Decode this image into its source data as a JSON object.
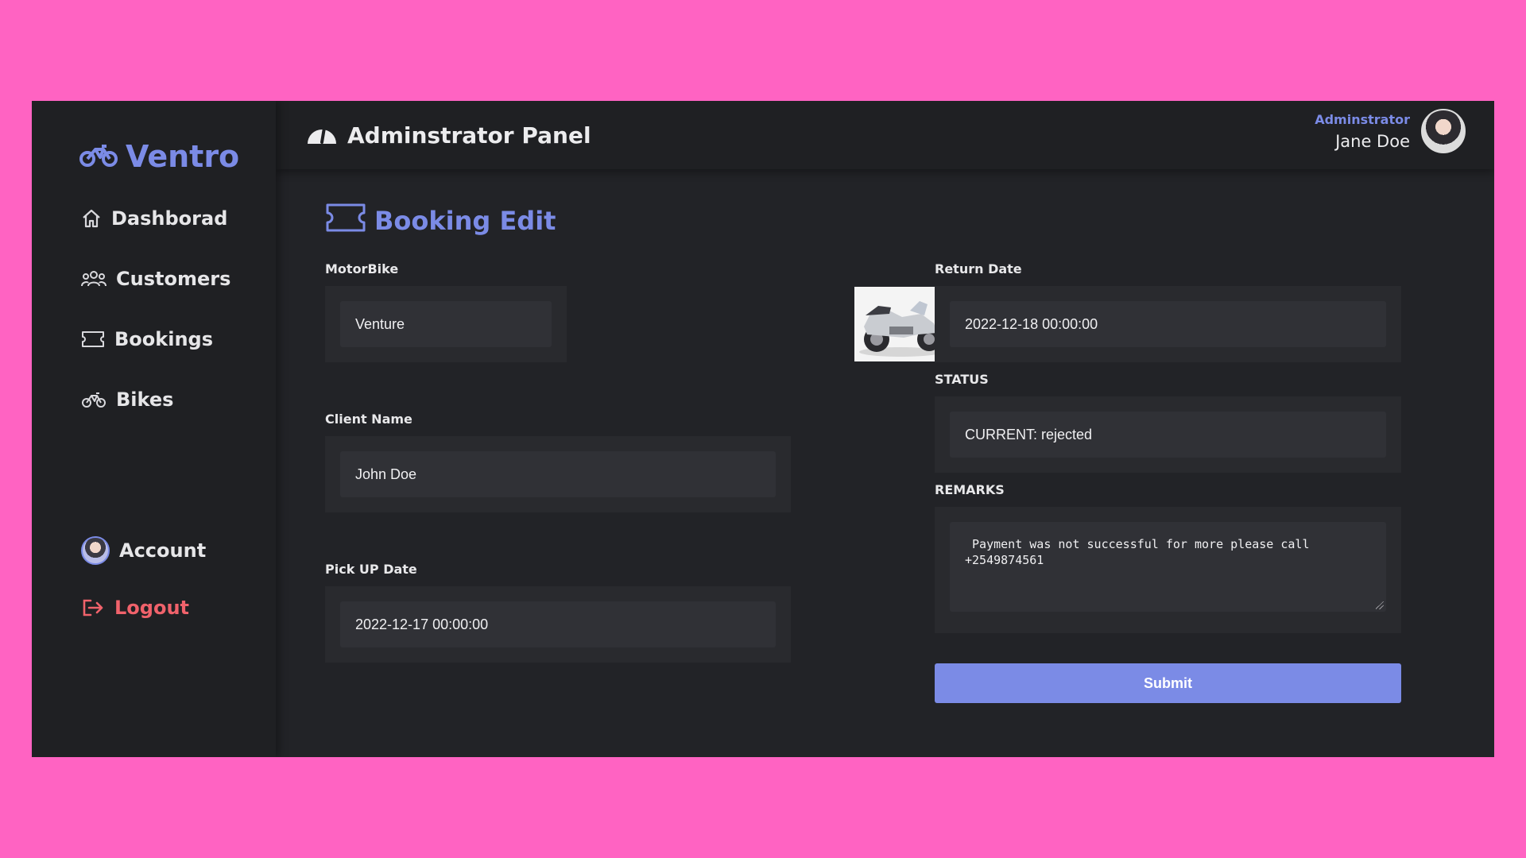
{
  "brand": {
    "name": "Ventro",
    "icon": "motorbike-icon",
    "color": "#7b8be6"
  },
  "sidebar": {
    "items": [
      {
        "label": "Dashborad",
        "icon": "home-icon"
      },
      {
        "label": "Customers",
        "icon": "users-icon"
      },
      {
        "label": "Bookings",
        "icon": "ticket-icon"
      },
      {
        "label": "Bikes",
        "icon": "motorbike-icon"
      }
    ],
    "account": {
      "label": "Account",
      "icon": "avatar"
    },
    "logout": {
      "label": "Logout",
      "icon": "logout-icon",
      "color": "#f0626b"
    }
  },
  "header": {
    "title": "Adminstrator Panel",
    "icon": "gauge-icon",
    "user": {
      "role": "Adminstrator",
      "name": "Jane Doe"
    }
  },
  "form": {
    "heading": "Booking Edit",
    "heading_icon": "ticket-icon",
    "motorbike": {
      "label": "MotorBike",
      "value": "Venture",
      "image": "motorbike-photo"
    },
    "client_name": {
      "label": "Client Name",
      "value": "John Doe"
    },
    "pickup_date": {
      "label": "Pick UP Date",
      "value": "2022-12-17 00:00:00"
    },
    "return_date": {
      "label": "Return Date",
      "value": "2022-12-18 00:00:00"
    },
    "status": {
      "label": "STATUS",
      "value": "CURRENT: rejected"
    },
    "remarks": {
      "label": "REMARKS",
      "value": " Payment was not successful for more please call +2549874561"
    },
    "submit_label": "Submit"
  },
  "colors": {
    "background": "#ff63c2",
    "panel": "#1f2023",
    "accent": "#7b8be6",
    "danger": "#f0626b"
  }
}
